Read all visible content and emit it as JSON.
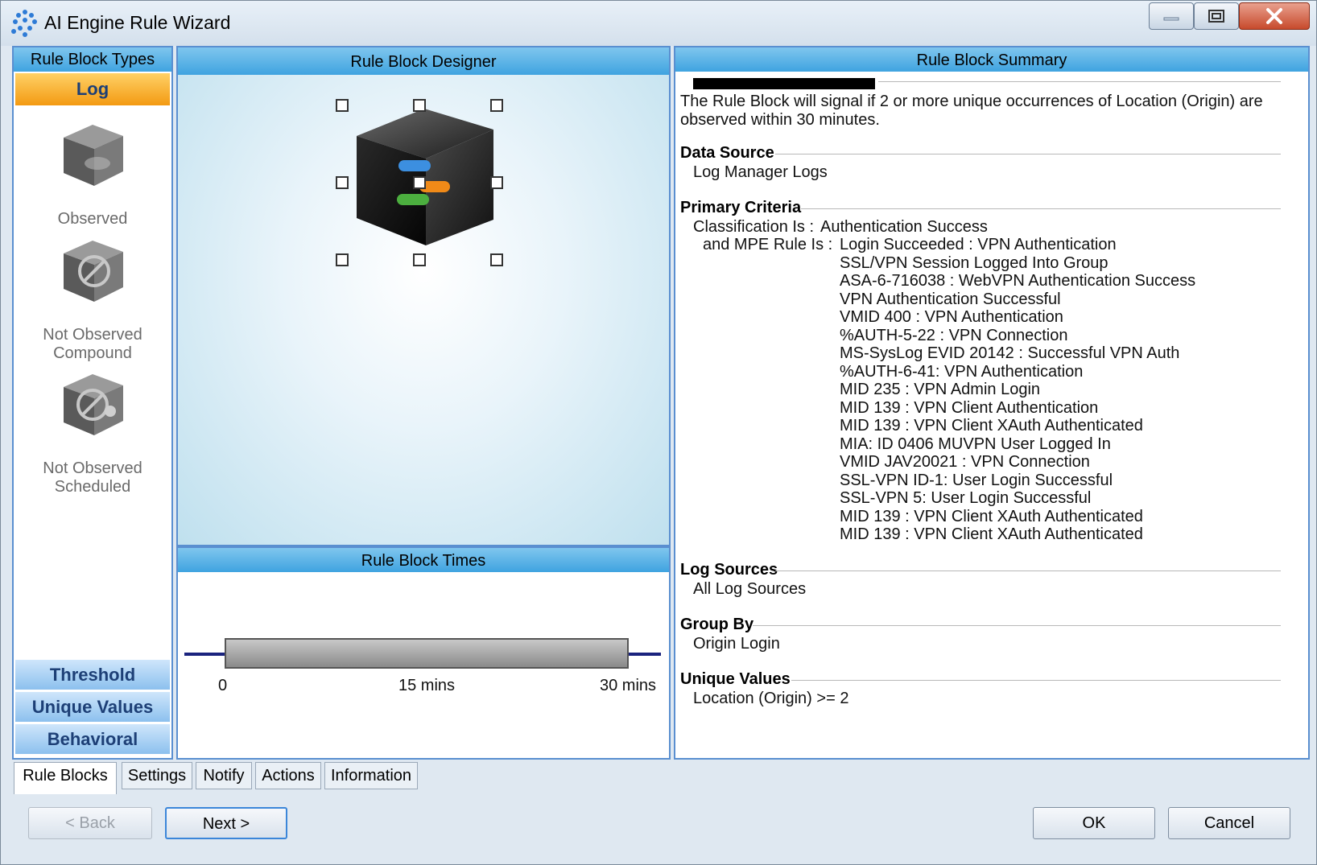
{
  "window": {
    "title": "AI Engine Rule Wizard",
    "controls": {
      "minimize": "minimize-icon",
      "maximize": "maximize-icon",
      "close": "close-icon"
    }
  },
  "left_panel": {
    "header": "Rule Block Types",
    "active_type": "Log",
    "block_types": [
      {
        "label": "Observed",
        "icon": "observed-cube-icon"
      },
      {
        "label": "Not Observed\nCompound",
        "icon": "not-observed-compound-cube-icon"
      },
      {
        "label": "Not Observed\nScheduled",
        "icon": "not-observed-scheduled-cube-icon"
      }
    ],
    "categories": [
      "Threshold",
      "Unique Values",
      "Behavioral"
    ]
  },
  "designer": {
    "header": "Rule Block Designer"
  },
  "times": {
    "header": "Rule Block Times",
    "ticks": [
      "0",
      "15 mins",
      "30 mins"
    ]
  },
  "summary": {
    "header": "Rule Block Summary",
    "description": "The Rule Block will signal if 2 or more unique occurrences of Location (Origin) are observed within 30 minutes.",
    "data_source": {
      "title": "Data Source",
      "value": "Log Manager Logs"
    },
    "primary_criteria": {
      "title": "Primary Criteria",
      "classification_label": "Classification Is :",
      "classification_value": "Authentication Success",
      "mpe_label": "and MPE Rule Is :",
      "mpe_rules": [
        "Login Succeeded : VPN Authentication",
        "SSL/VPN Session Logged Into Group",
        "ASA-6-716038 : WebVPN Authentication Success",
        "VPN Authentication Successful",
        "VMID 400 : VPN Authentication",
        "%AUTH-5-22 : VPN Connection",
        "MS-SysLog EVID 20142 : Successful VPN Auth",
        "%AUTH-6-41: VPN Authentication",
        "MID 235 : VPN Admin Login",
        "MID 139 : VPN Client Authentication",
        "MID 139 : VPN Client XAuth Authenticated",
        "MIA: ID 0406 MUVPN User Logged In",
        "VMID JAV20021 : VPN Connection",
        "SSL-VPN ID-1: User Login Successful",
        "SSL-VPN 5: User Login Successful",
        "MID 139 : VPN Client XAuth Authenticated",
        "MID 139 : VPN Client XAuth Authenticated"
      ]
    },
    "log_sources": {
      "title": "Log Sources",
      "value": "All Log Sources"
    },
    "group_by": {
      "title": "Group By",
      "value": "Origin Login"
    },
    "unique_values": {
      "title": "Unique Values",
      "value": "Location (Origin) >= 2"
    }
  },
  "tabs": [
    "Rule Blocks",
    "Settings",
    "Notify",
    "Actions",
    "Information"
  ],
  "active_tab": "Rule Blocks",
  "footer": {
    "back": "< Back",
    "next": "Next >",
    "ok": "OK",
    "cancel": "Cancel"
  }
}
